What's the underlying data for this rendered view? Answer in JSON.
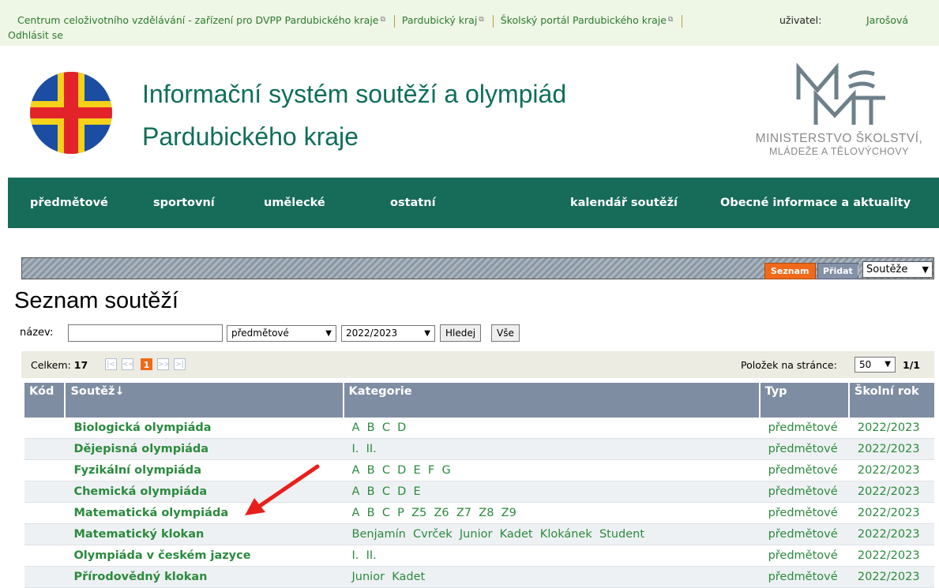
{
  "topbar": {
    "link1": "Centrum celoživotního vzdělávání - zařízení pro DVPP Pardubického kraje",
    "link2": "Pardubický kraj",
    "link3": "Školský portál Pardubického kraje",
    "user_label": "uživatel:",
    "user_name": "Jarošová",
    "logout": "Odhlásit se"
  },
  "header": {
    "title_line1": "Informační systém soutěží a olympiád",
    "title_line2": "Pardubického kraje",
    "ministry_line1": "MINISTERSTVO ŠKOLSTVÍ,",
    "ministry_line2": "MLÁDEŽE A TĚLOVÝCHOVY"
  },
  "nav": [
    "předmětové",
    "sportovní",
    "umělecké",
    "ostatní",
    "kalendář soutěží",
    "Obecné informace a aktuality"
  ],
  "toolbar": {
    "seznam": "Seznam",
    "pridat": "Přidat",
    "select_value": "Soutěže"
  },
  "page_title": "Seznam soutěží",
  "filter": {
    "label": "název:",
    "name_value": "",
    "type_value": "předmětové",
    "year_value": "2022/2023",
    "search_button": "Hledej",
    "all_button": "Vše"
  },
  "pager": {
    "total_label": "Celkem:",
    "total": "17",
    "first": "|<",
    "prev": "<<",
    "current": "1",
    "next": ">>",
    "last": ">|",
    "per_page_label": "Položek na stránce:",
    "per_page": "50",
    "pages": "1/1"
  },
  "table": {
    "headers": [
      "Kód",
      "Soutěž↓",
      "Kategorie",
      "Typ",
      "Školní rok"
    ],
    "rows": [
      {
        "name": "Biologická olympiáda",
        "categories": "A  B  C  D",
        "type": "předmětové",
        "year": "2022/2023"
      },
      {
        "name": "Dějepisná olympiáda",
        "categories": "I.  II.",
        "type": "předmětové",
        "year": "2022/2023"
      },
      {
        "name": "Fyzikální olympiáda",
        "categories": "A  B  C  D  E  F  G",
        "type": "předmětové",
        "year": "2022/2023"
      },
      {
        "name": "Chemická olympiáda",
        "categories": "A  B  C  D  E",
        "type": "předmětové",
        "year": "2022/2023"
      },
      {
        "name": "Matematická olympiáda",
        "categories": "A  B  C  P  Z5  Z6  Z7  Z8  Z9",
        "type": "předmětové",
        "year": "2022/2023"
      },
      {
        "name": "Matematický klokan",
        "categories": "Benjamín  Cvrček  Junior  Kadet  Klokánek  Student",
        "type": "předmětové",
        "year": "2022/2023"
      },
      {
        "name": "Olympiáda v českém jazyce",
        "categories": "I.  II.",
        "type": "předmětové",
        "year": "2022/2023"
      },
      {
        "name": "Přírodovědný klokan",
        "categories": "Junior  Kadet",
        "type": "předmětové",
        "year": "2022/2023"
      }
    ]
  },
  "colors": {
    "nav_bg": "#176b59",
    "accent": "#f06a1a",
    "link_green": "#2b8a3e",
    "table_header": "#7f8da3"
  },
  "icons": {
    "external": "external-link-icon",
    "dropdown": "chevron-down-icon",
    "annotation": "red-arrow-icon"
  }
}
